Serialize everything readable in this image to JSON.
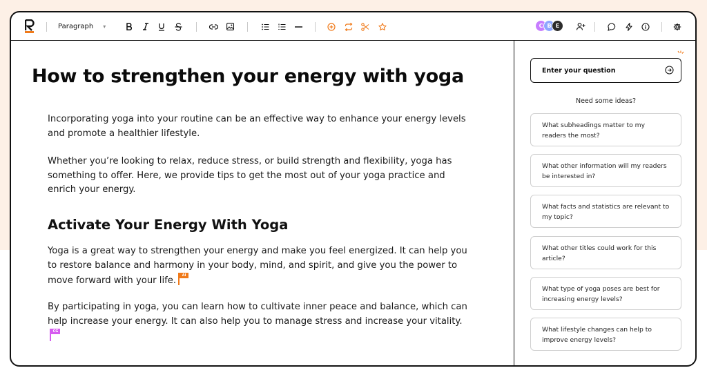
{
  "toolbar": {
    "paragraph_style": "Paragraph",
    "icons": [
      "bold-icon",
      "italic-icon",
      "underline-icon",
      "strikethrough-icon",
      "link-icon",
      "image-icon",
      "bullet-list-icon",
      "numbered-list-icon",
      "divider-icon",
      "ai-circle-icon",
      "repeat-icon",
      "scissors-icon",
      "star-icon",
      "add-user-icon",
      "comment-icon",
      "bolt-icon",
      "info-icon",
      "settings-icon"
    ],
    "avatars": [
      {
        "letter": "C",
        "color": "#c77dff"
      },
      {
        "letter": "B",
        "color": "#8ea6ff"
      },
      {
        "letter": "E",
        "color": "#2b2b2b"
      }
    ],
    "accent": "#f07a1a"
  },
  "document": {
    "title": "How to strengthen your energy with yoga",
    "p1": "Incorporating yoga into your routine can be an effective way to enhance your energy levels and promote a healthier lifestyle.",
    "p2": "Whether you’re looking to relax, reduce stress, or build strength and flexibility, yoga has something to offer. Here, we provide tips to get the most out of your yoga practice and enrich your energy.",
    "h2": "Activate Your Energy With Yoga",
    "p3": "Yoga is a great way to strengthen your energy and make you feel energized. It can help you to restore balance and harmony in your body, mind, and spirit, and give you the power to move forward with your life.",
    "p4": "By participating in yoga, you can learn how to cultivate inner peace and balance, which can help increase your energy. It can also help you to manage stress and increase your vitality.",
    "flag1": {
      "label": "AI",
      "color": "#f07a1a"
    },
    "flag2": {
      "label": "CG",
      "color": "#d65cf0"
    }
  },
  "sidebar": {
    "ask_placeholder": "Enter your question",
    "ideas_label": "Need some ideas?",
    "ideas": [
      "What subheadings matter to my readers the most?",
      "What other information will my readers be interested in?",
      "What facts and statistics are relevant to my topic?",
      "What other titles could work for this article?",
      "What type of yoga poses are best for increasing energy levels?",
      "What lifestyle changes can help to improve energy levels?"
    ]
  }
}
